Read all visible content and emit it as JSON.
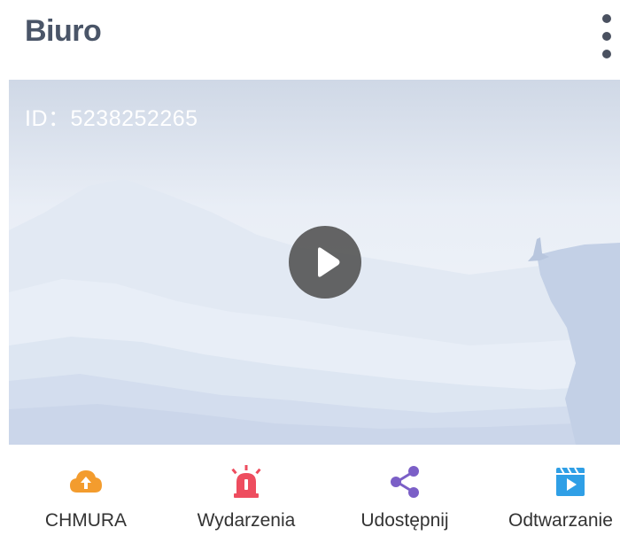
{
  "header": {
    "title": "Biuro",
    "menu_icon": "more-vertical-icon"
  },
  "video": {
    "device_id": "ID：5238252265",
    "play_icon": "play-icon"
  },
  "actions": [
    {
      "label": "CHMURA",
      "icon": "cloud-upload-icon",
      "color": "#f39c2e"
    },
    {
      "label": "Wydarzenia",
      "icon": "alarm-siren-icon",
      "color": "#ee4d5f"
    },
    {
      "label": "Udostępnij",
      "icon": "share-icon",
      "color": "#7b5fc7"
    },
    {
      "label": "Odtwarzanie",
      "icon": "playback-video-icon",
      "color": "#2f9fe6"
    }
  ]
}
